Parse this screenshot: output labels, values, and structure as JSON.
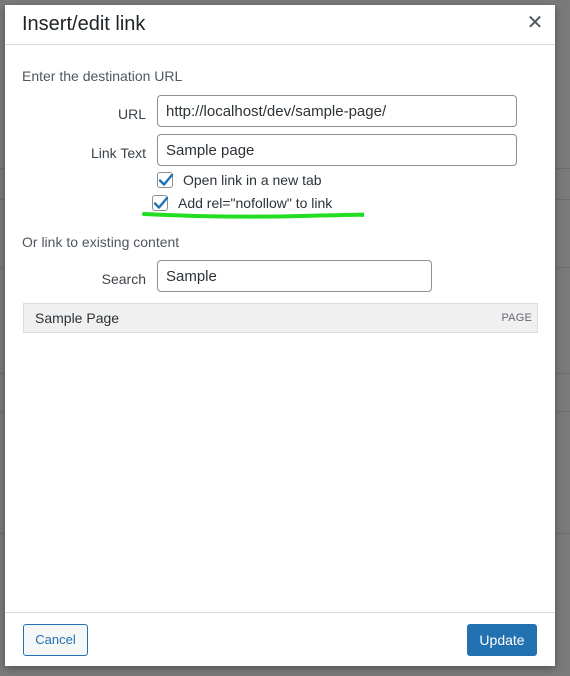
{
  "dialog": {
    "title": "Insert/edit link",
    "close_icon": "close-icon"
  },
  "destination": {
    "section_label": "Enter the destination URL",
    "url_label": "URL",
    "url_value": "http://localhost/dev/sample-page/",
    "link_text_label": "Link Text",
    "link_text_value": "Sample page",
    "open_new_tab_label": "Open link in a new tab",
    "open_new_tab_checked": true,
    "nofollow_label": "Add rel=\"nofollow\" to link",
    "nofollow_checked": true
  },
  "existing": {
    "section_label": "Or link to existing content",
    "search_label": "Search",
    "search_value": "Sample",
    "results": [
      {
        "title": "Sample Page",
        "type": "PAGE"
      }
    ]
  },
  "footer": {
    "cancel_label": "Cancel",
    "update_label": "Update"
  },
  "colors": {
    "accent": "#2271b1",
    "annotation": "#22dd22",
    "checkmark": "#2271b1"
  }
}
